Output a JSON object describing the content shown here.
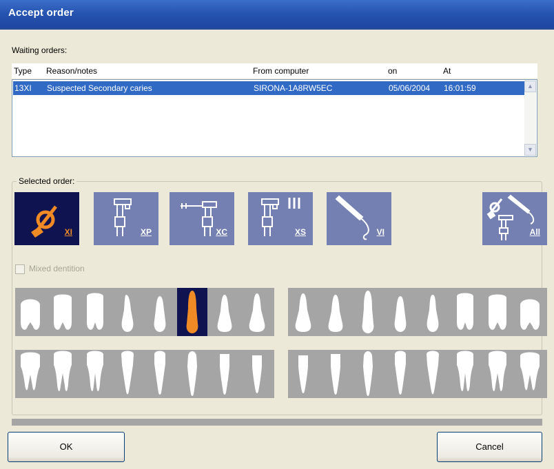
{
  "window": {
    "title": "Accept order"
  },
  "waiting_orders": {
    "label": "Waiting orders:",
    "columns": [
      "Type",
      "Reason/notes",
      "From computer",
      "on",
      "At"
    ],
    "rows": [
      {
        "type": "13XI",
        "reason": "Suspected Secondary caries",
        "computer": "SIRONA-1A8RW5EC",
        "on": "05/06/2004",
        "at": "16:01:59",
        "selected": true
      }
    ]
  },
  "selected_order": {
    "label": "Selected order:",
    "tools": [
      {
        "id": "xi",
        "label": "XI",
        "icon": "intraoral-sensor-icon",
        "selected": true
      },
      {
        "id": "xp",
        "label": "XP",
        "icon": "panoramic-xray-icon",
        "selected": false
      },
      {
        "id": "xc",
        "label": "XC",
        "icon": "cephalometric-xray-icon",
        "selected": false
      },
      {
        "id": "xs",
        "label": "XS",
        "icon": "multi-xray-icon",
        "selected": false
      },
      {
        "id": "vi",
        "label": "VI",
        "icon": "intraoral-camera-icon",
        "selected": false
      },
      {
        "id": "all",
        "label": "All",
        "icon": "all-devices-icon",
        "selected": false
      }
    ],
    "mixed_dentition": {
      "label": "Mixed dentition",
      "checked": false,
      "enabled": false
    },
    "selected_tooth": {
      "row": "upper",
      "index": 5
    }
  },
  "buttons": {
    "ok": "OK",
    "cancel": "Cancel"
  },
  "colors": {
    "selection_blue": "#316ac5",
    "tool_blue": "#7480b2",
    "selected_navy": "#0f1450",
    "highlight_orange": "#f08a24",
    "strip_gray": "#a5a5a5",
    "dialog_bg": "#ece9d8"
  }
}
